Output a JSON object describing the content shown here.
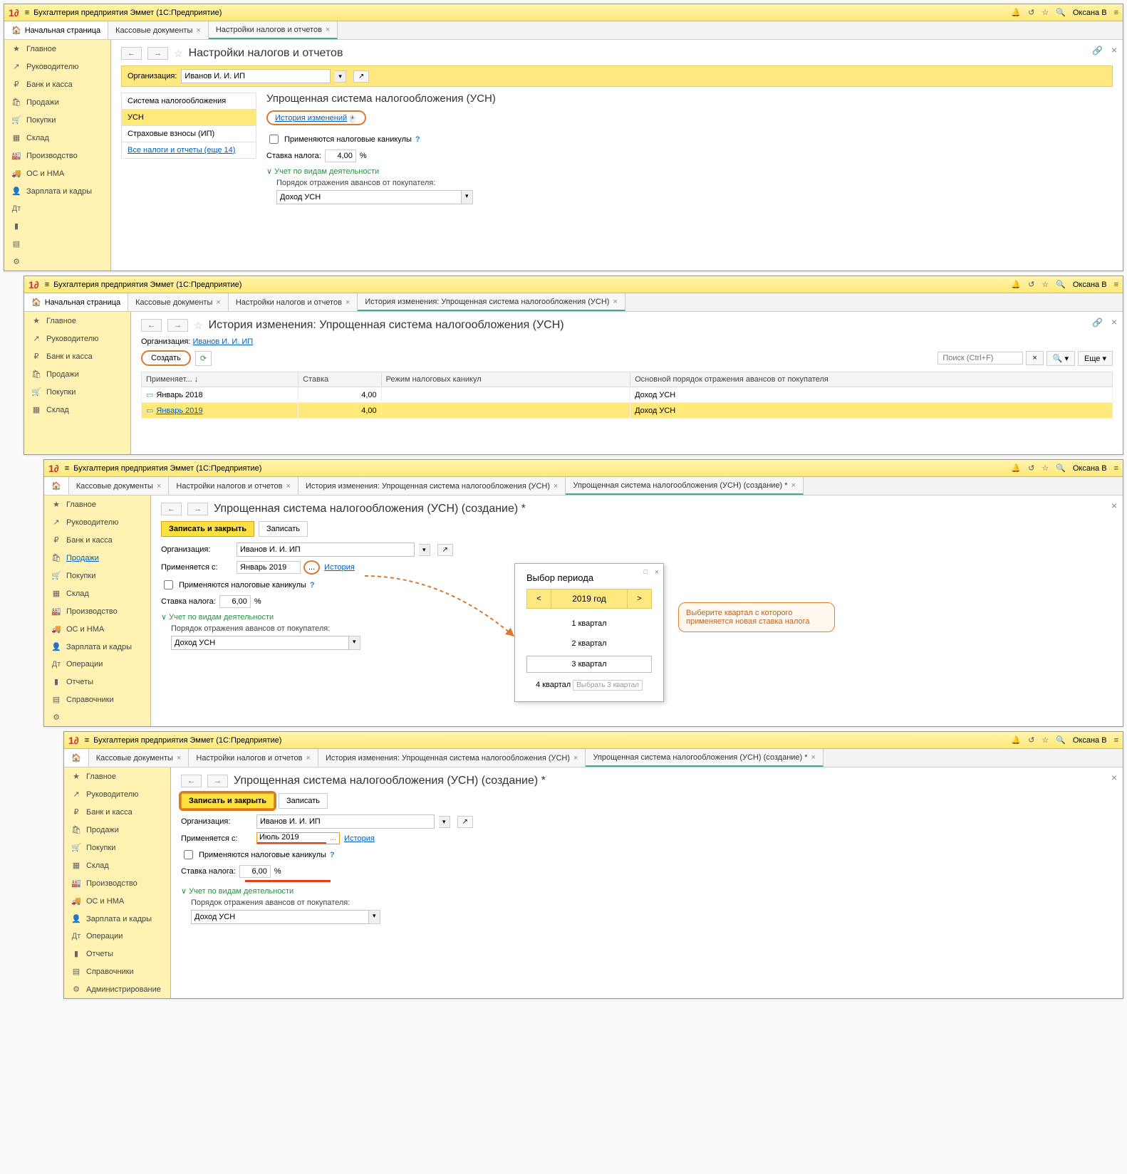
{
  "app_title": "Бухгалтерия предприятия Эммет  (1C:Предприятие)",
  "user_name": "Оксана В",
  "home_tab": "Начальная страница",
  "tabs": {
    "kassa": "Кассовые документы",
    "settings": "Настройки налогов и отчетов",
    "history": "История изменения: Упрощенная система налогообложения (УСН)",
    "create": "Упрощенная система налогообложения (УСН) (создание) *"
  },
  "sidebar": [
    {
      "icon": "★",
      "label": "Главное"
    },
    {
      "icon": "↗",
      "label": "Руководителю"
    },
    {
      "icon": "₽",
      "label": "Банк и касса"
    },
    {
      "icon": "🛍",
      "label": "Продажи"
    },
    {
      "icon": "🛒",
      "label": "Покупки"
    },
    {
      "icon": "▦",
      "label": "Склад"
    },
    {
      "icon": "🏭",
      "label": "Производство"
    },
    {
      "icon": "🚚",
      "label": "ОС и НМА"
    },
    {
      "icon": "👤",
      "label": "Зарплата и кадры"
    },
    {
      "icon": "Дт",
      "label": "Операции"
    },
    {
      "icon": "▮",
      "label": "Отчеты"
    },
    {
      "icon": "▤",
      "label": "Справочники"
    },
    {
      "icon": "⚙",
      "label": "Администрирование"
    }
  ],
  "screen1": {
    "title": "Настройки налогов и отчетов",
    "org_label": "Организация:",
    "org_value": "Иванов И. И. ИП",
    "taxnav": {
      "system": "Система налогообложения",
      "usn": "УСН",
      "insurance": "Страховые взносы (ИП)",
      "all": "Все налоги и отчеты (еще 14)"
    },
    "section_title": "Упрощенная система налогообложения (УСН)",
    "history_link": "История изменений",
    "tax_holiday_cb": "Применяются налоговые каникулы",
    "rate_label": "Ставка налога:",
    "rate_value": "4,00",
    "percent": "%",
    "activity_toggle": "Учет по видам деятельности",
    "advance_label": "Порядок отражения авансов от покупателя:",
    "advance_value": "Доход УСН"
  },
  "screen2": {
    "title": "История изменения: Упрощенная система налогообложения (УСН)",
    "org_label": "Организация:",
    "org_value": "Иванов И. И. ИП",
    "create_btn": "Создать",
    "search_ph": "Поиск (Ctrl+F)",
    "more_btn": "Еще",
    "cols": {
      "applied": "Применяет...",
      "rate": "Ставка",
      "regime": "Режим налоговых каникул",
      "main_order": "Основной порядок отражения авансов от покупателя"
    },
    "rows": [
      {
        "period": "Январь 2018",
        "rate": "4,00",
        "order": "Доход УСН"
      },
      {
        "period": "Январь 2019",
        "rate": "4,00",
        "order": "Доход УСН"
      }
    ]
  },
  "screen3": {
    "title": "Упрощенная система налогообложения (УСН) (создание) *",
    "save_close": "Записать и закрыть",
    "save": "Записать",
    "org_label": "Организация:",
    "org_value": "Иванов И. И. ИП",
    "applied_label": "Применяется с:",
    "applied_value": "Январь 2019",
    "history_link": "История",
    "tax_holiday_cb": "Применяются налоговые каникулы",
    "rate_label": "Ставка налога:",
    "rate_value": "6,00",
    "activity_toggle": "Учет по видам деятельности",
    "advance_label": "Порядок отражения авансов от покупателя:",
    "advance_value": "Доход УСН",
    "popup": {
      "title": "Выбор периода",
      "year": "2019 год",
      "q1": "1 квартал",
      "q2": "2 квартал",
      "q3": "3 квартал",
      "q4": "4 квартал",
      "select_hint": "Выбрать 3 квартал"
    },
    "callout": "Выберите квартал с которого применяется новая ставка налога"
  },
  "screen4": {
    "title": "Упрощенная система налогообложения (УСН) (создание) *",
    "save_close": "Записать и закрыть",
    "save": "Записать",
    "org_label": "Организация:",
    "org_value": "Иванов И. И. ИП",
    "applied_label": "Применяется с:",
    "applied_value": "Июль 2019",
    "history_link": "История",
    "tax_holiday_cb": "Применяются налоговые каникулы",
    "rate_label": "Ставка налога:",
    "rate_value": "6,00",
    "activity_toggle": "Учет по видам деятельности",
    "advance_label": "Порядок отражения авансов от покупателя:",
    "advance_value": "Доход УСН"
  }
}
